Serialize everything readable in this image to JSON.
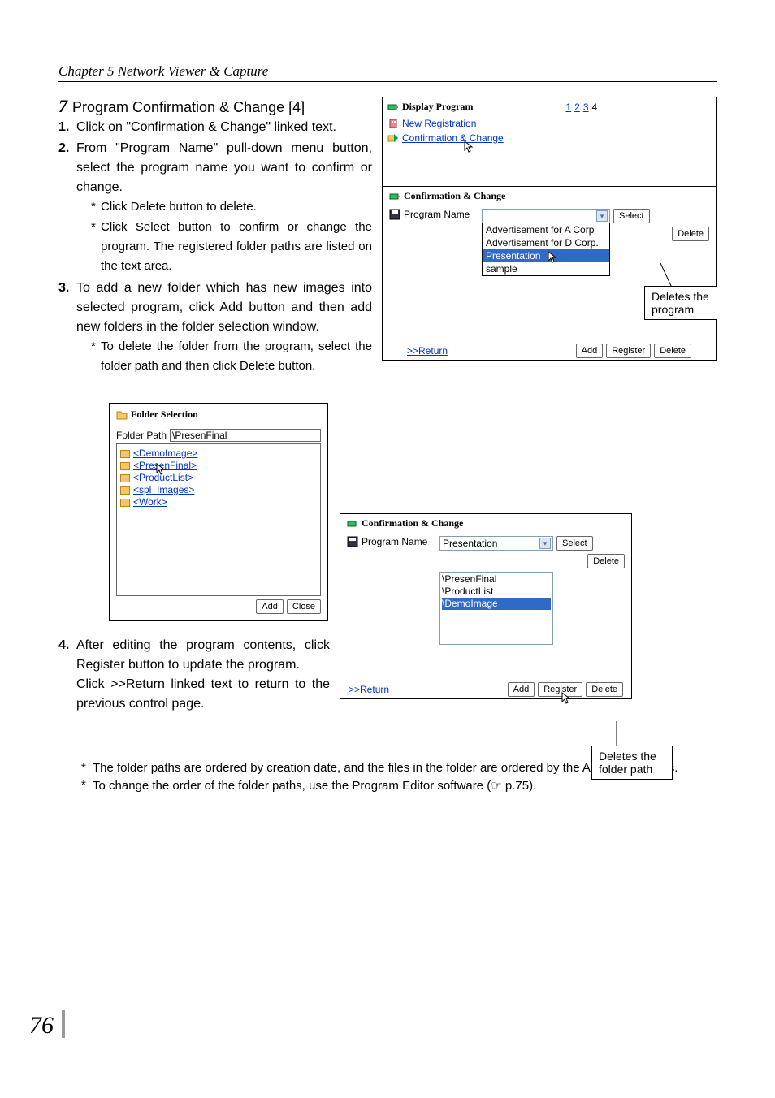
{
  "chapter_header": "Chapter 5 Network Viewer & Capture",
  "section": {
    "num": "7",
    "title": "Program Confirmation & Change [4]"
  },
  "steps": {
    "s1": {
      "num": "1.",
      "text": "Click on \"Confirmation & Change\" linked text."
    },
    "s2": {
      "num": "2.",
      "text": "From \"Program Name\" pull-down menu button, select the program name you want to confirm or change."
    },
    "s2_notes": [
      "Click Delete button to delete.",
      "Click Select button to confirm or change the program. The registered folder paths are listed on the text area."
    ],
    "s3": {
      "num": "3.",
      "text": "To add a new folder which has new images into selected program, click Add button and then add new folders in the folder selection window."
    },
    "s3_notes": [
      "To delete the folder from the program, select the folder path and then click Delete button."
    ],
    "s4": {
      "num": "4.",
      "text_a": "After editing the program contents, click Register button to update the program.",
      "text_b": "Click  >>Return linked text to return to the previous control page."
    }
  },
  "footnotes": [
    "The folder paths are ordered by creation date, and the files in the folder are ordered by the ASCII characters.",
    "To change the order of the folder paths, use the Program Editor software (☞ p.75)."
  ],
  "page_number": "76",
  "panel_top": {
    "display_program": "Display Program",
    "nums": [
      "1",
      "2",
      "3",
      "4"
    ],
    "new_reg": "New Registration",
    "conf_change_link": "Confirmation & Change"
  },
  "conf_change": {
    "title": "Confirmation & Change",
    "program_name_label": "Program Name",
    "select_btn": "Select",
    "delete_btn": "Delete",
    "options": [
      "Advertisement for A Corp",
      "Advertisement for D Corp.",
      "Presentation",
      "sample"
    ],
    "selected_index": 2,
    "return": ">>Return",
    "add_btn": "Add",
    "register_btn": "Register",
    "delete_btn2": "Delete"
  },
  "callout_top": "Deletes the program",
  "folder_selection": {
    "title": "Folder Selection",
    "path_label": "Folder Path",
    "path_value": "\\PresenFinal",
    "folders": [
      "<DemoImage>",
      "<PresenFinal>",
      "<ProductList>",
      "<spl_Images>",
      "<Work>"
    ],
    "add_btn": "Add",
    "close_btn": "Close"
  },
  "bottom_panel": {
    "title": "Confirmation & Change",
    "program_name_label": "Program Name",
    "selected": "Presentation",
    "select_btn": "Select",
    "delete_btn": "Delete",
    "list": [
      "\\PresenFinal",
      "\\ProductList",
      "\\DemoImage"
    ],
    "hl_index": 2,
    "return": ">>Return",
    "add_btn": "Add",
    "register_btn": "Register",
    "delete_btn2": "Delete"
  },
  "callout_bottom": "Deletes the folder path"
}
